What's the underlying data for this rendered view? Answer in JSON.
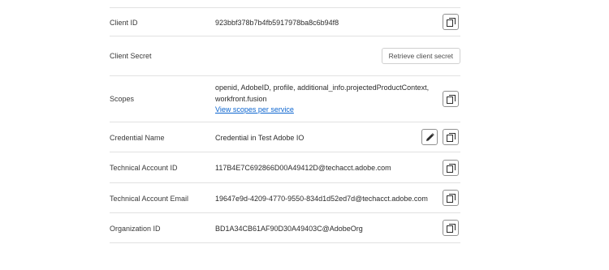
{
  "credentials": {
    "client_id": {
      "label": "Client ID",
      "value": "923bbf378b7b4fb5917978ba8c6b94f8"
    },
    "client_secret": {
      "label": "Client Secret",
      "button": "Retrieve client secret"
    },
    "scopes": {
      "label": "Scopes",
      "line1": "openid, AdobeID, profile, additional_info.projectedProductContext,",
      "line2": "workfront.fusion",
      "link": "View scopes per service"
    },
    "credential_name": {
      "label": "Credential Name",
      "value": "Credential in Test Adobe IO"
    },
    "technical_account_id": {
      "label": "Technical Account ID",
      "value": "117B4E7C692866D00A49412D@techacct.adobe.com"
    },
    "technical_account_email": {
      "label": "Technical Account Email",
      "value": "19647e9d-4209-4770-9550-834d1d52ed7d@techacct.adobe.com"
    },
    "organization_id": {
      "label": "Organization ID",
      "value": "BD1A34CB61AF90D30A49403C@AdobeOrg"
    }
  },
  "icons": {
    "copy": "copy-icon",
    "edit": "edit-pencil-icon"
  }
}
